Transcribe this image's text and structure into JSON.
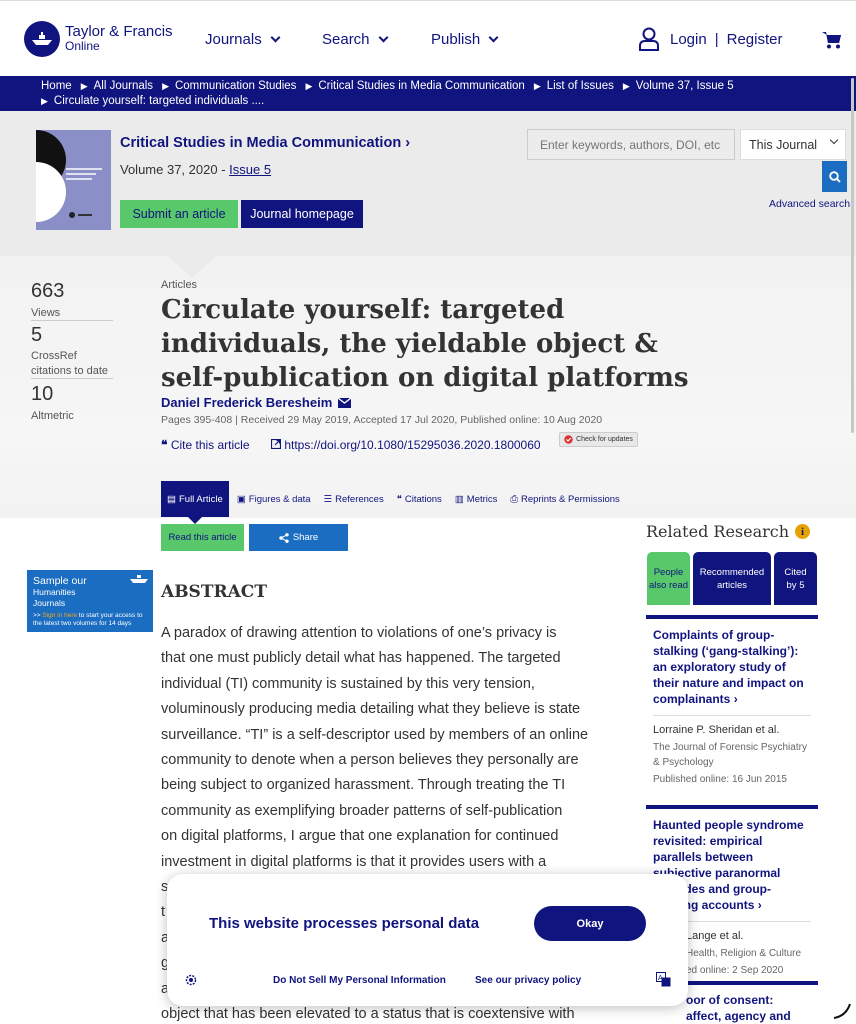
{
  "header": {
    "logo_name": "Taylor & Francis",
    "logo_sub": "Online",
    "nav": [
      "Journals",
      "Search",
      "Publish"
    ],
    "login": "Login",
    "separator": "|",
    "register": "Register"
  },
  "breadcrumb": {
    "items": [
      "Home",
      "All Journals",
      "Communication Studies",
      "Critical Studies in Media Communication",
      "List of Issues",
      "Volume 37, Issue 5",
      "Circulate yourself: targeted individuals ...."
    ]
  },
  "journal": {
    "title": "Critical Studies in Media Communication",
    "title_arrow": "›",
    "volume_text": "Volume 37, 2020 - ",
    "issue_link": "Issue 5",
    "submit_label": "Submit an article",
    "homepage_label": "Journal homepage"
  },
  "search": {
    "placeholder": "Enter keywords, authors, DOI, etc",
    "scope": "This Journal",
    "advanced": "Advanced search"
  },
  "metrics": [
    {
      "value": "663",
      "label": "Views"
    },
    {
      "value": "5",
      "label": "CrossRef citations to date"
    },
    {
      "value": "10",
      "label": "Altmetric"
    }
  ],
  "article": {
    "type": "Articles",
    "title": "Circulate yourself: targeted individuals, the yieldable object & self-publication on digital platforms",
    "author": "Daniel Frederick Beresheim",
    "pages_line": "Pages 395-408 | Received 29 May 2019, Accepted 17 Jul 2020, Published online: 10 Aug 2020",
    "cite_label": "Cite this article",
    "doi": "https://doi.org/10.1080/15295036.2020.1800060",
    "check_updates": "Check for updates"
  },
  "tabs": [
    "Full Article",
    "Figures & data",
    "References",
    "Citations",
    "Metrics",
    "Reprints & Permissions"
  ],
  "actions": {
    "read": "Read this article",
    "share": "Share"
  },
  "promo": {
    "line1": "Sample our",
    "line2a": "Humanities",
    "line2b": "Journals",
    "line3_pre": ">> ",
    "line3_link": "Sign in here",
    "line3_post": " to start your access to the latest two volumes for 14 days"
  },
  "abstract": {
    "heading": "ABSTRACT",
    "lines": [
      "A paradox of drawing attention to violations of one’s privacy is",
      "that one must publicly detail what has happened. The targeted",
      "individual (TI) community is sustained by this very tension,",
      "voluminously producing media detailing what they believe is state",
      "surveillance. “TI” is a self-descriptor used by members of an online",
      "community to denote when a person believes they personally are",
      "being subject to organized harassment. Through treating the TI",
      "community as exemplifying broader patterns of self-publication",
      "on digital platforms, I argue that one explanation for continued",
      "investment in digital platforms is that it provides users with a",
      "s",
      "t",
      "a",
      "g",
      "a",
      "object that has been elevated to a status that is coextensive with"
    ]
  },
  "related": {
    "title": "Related Research",
    "info": "i",
    "tabs": [
      "People also read",
      "Recommended articles",
      "Cited by 5"
    ],
    "cards": [
      {
        "title": "Complaints of group-stalking (‘gang-stalking’): an exploratory study of their nature and impact on complainants",
        "arrow": "›",
        "authors": "Lorraine P. Sheridan et al.",
        "journal": "The Journal of Forensic Psychiatry & Psychology",
        "published": "Published online: 16 Jun 2015"
      },
      {
        "title": "Haunted people syndrome revisited: empirical parallels between subjective paranormal episodes and group-stalking accounts",
        "arrow": "›",
        "authors": "Lange et al.",
        "journal": "Health, Religion & Culture",
        "published": "ed online: 2 Sep 2020"
      },
      {
        "title": "oor of consent: affect, agency and whiteness in",
        "arrow": "",
        "authors": "",
        "journal": "",
        "published": ""
      }
    ]
  },
  "cookie": {
    "title": "This website processes personal data",
    "okay": "Okay",
    "do_not_sell": "Do Not Sell My Personal Information",
    "privacy": "See our privacy policy"
  },
  "colors": {
    "brand_navy": "#10147e",
    "accent_green": "#58c86a",
    "accent_blue": "#1a6dc0"
  }
}
